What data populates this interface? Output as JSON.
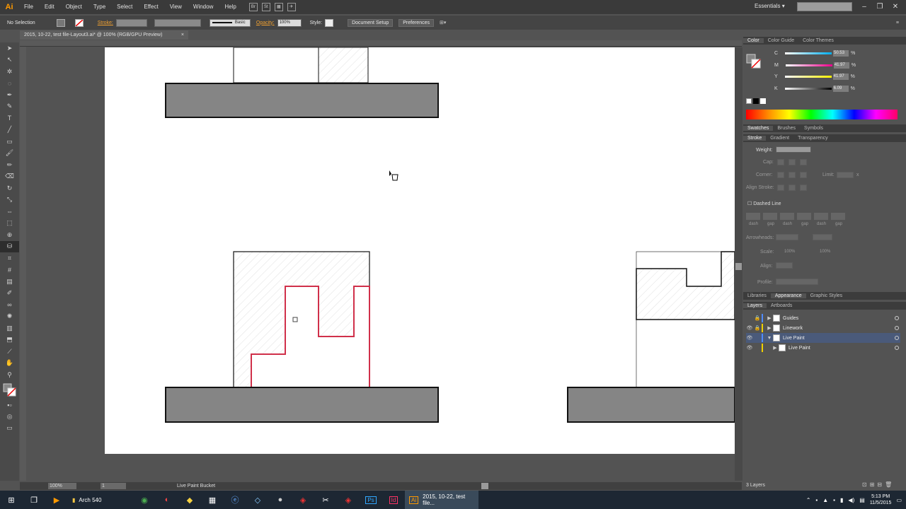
{
  "app": {
    "logo": "Ai"
  },
  "menu": {
    "items": [
      "File",
      "Edit",
      "Object",
      "Type",
      "Select",
      "Effect",
      "View",
      "Window",
      "Help"
    ],
    "bridge": [
      "Br",
      "St"
    ]
  },
  "workspace": "Essentials",
  "control_bar": {
    "selection": "No Selection",
    "stroke_label": "Stroke:",
    "brush": "Basic",
    "opacity_label": "Opacity:",
    "opacity_value": "100%",
    "style_label": "Style:",
    "document_setup": "Document Setup",
    "preferences": "Preferences"
  },
  "document_tab": {
    "title": "2015, 10-22, test file-Layout3.ai* @ 100% (RGB/GPU Preview)",
    "close": "×"
  },
  "status_bar": {
    "zoom": "100%",
    "page": "1",
    "tool": "Live Paint Bucket"
  },
  "color_panel": {
    "tabs": [
      "Color",
      "Color Guide",
      "Color Themes"
    ],
    "channels": [
      {
        "label": "C",
        "value": "50.53",
        "unit": "%"
      },
      {
        "label": "M",
        "value": "41.97",
        "unit": "%"
      },
      {
        "label": "Y",
        "value": "41.97",
        "unit": "%"
      },
      {
        "label": "K",
        "value": "6.09",
        "unit": "%"
      }
    ]
  },
  "swatches_tabs": [
    "Swatches",
    "Brushes",
    "Symbols"
  ],
  "stroke_tabs": [
    "Stroke",
    "Gradient",
    "Transparency"
  ],
  "stroke_panel": {
    "weight": "Weight:",
    "cap": "Cap:",
    "corner": "Corner:",
    "limit": "Limit:",
    "limit_x": "x",
    "align": "Align Stroke:",
    "dashed": "Dashed Line",
    "dash_labels": [
      "dash",
      "gap",
      "dash",
      "gap",
      "dash",
      "gap"
    ],
    "arrowheads": "Arrowheads:",
    "scale": "Scale:",
    "scale_values": [
      "100%",
      "100%"
    ],
    "align2": "Align:",
    "profile": "Profile:"
  },
  "library_tabs": [
    "Libraries",
    "Appearance",
    "Graphic Styles"
  ],
  "layers_tabs": [
    "Layers",
    "Artboards"
  ],
  "layers": [
    {
      "name": "Guides",
      "color": "#4f8bff"
    },
    {
      "name": "Linework",
      "color": "#f0d000"
    },
    {
      "name": "Live Paint",
      "color": "#4f8bff"
    },
    {
      "name": "Live Paint",
      "color": "#f0d000"
    }
  ],
  "layers_count": "3 Layers",
  "taskbar": {
    "folder": "Arch 540",
    "ai_task": "2015, 10-22, test file...",
    "ai_icon": "Ai",
    "ps_icon": "Ps",
    "id_icon": "Id",
    "time": "5:13 PM",
    "date": "11/5/2015"
  },
  "colors": {
    "accent_stroke": "#d0304a",
    "fill_gray": "#858585"
  }
}
